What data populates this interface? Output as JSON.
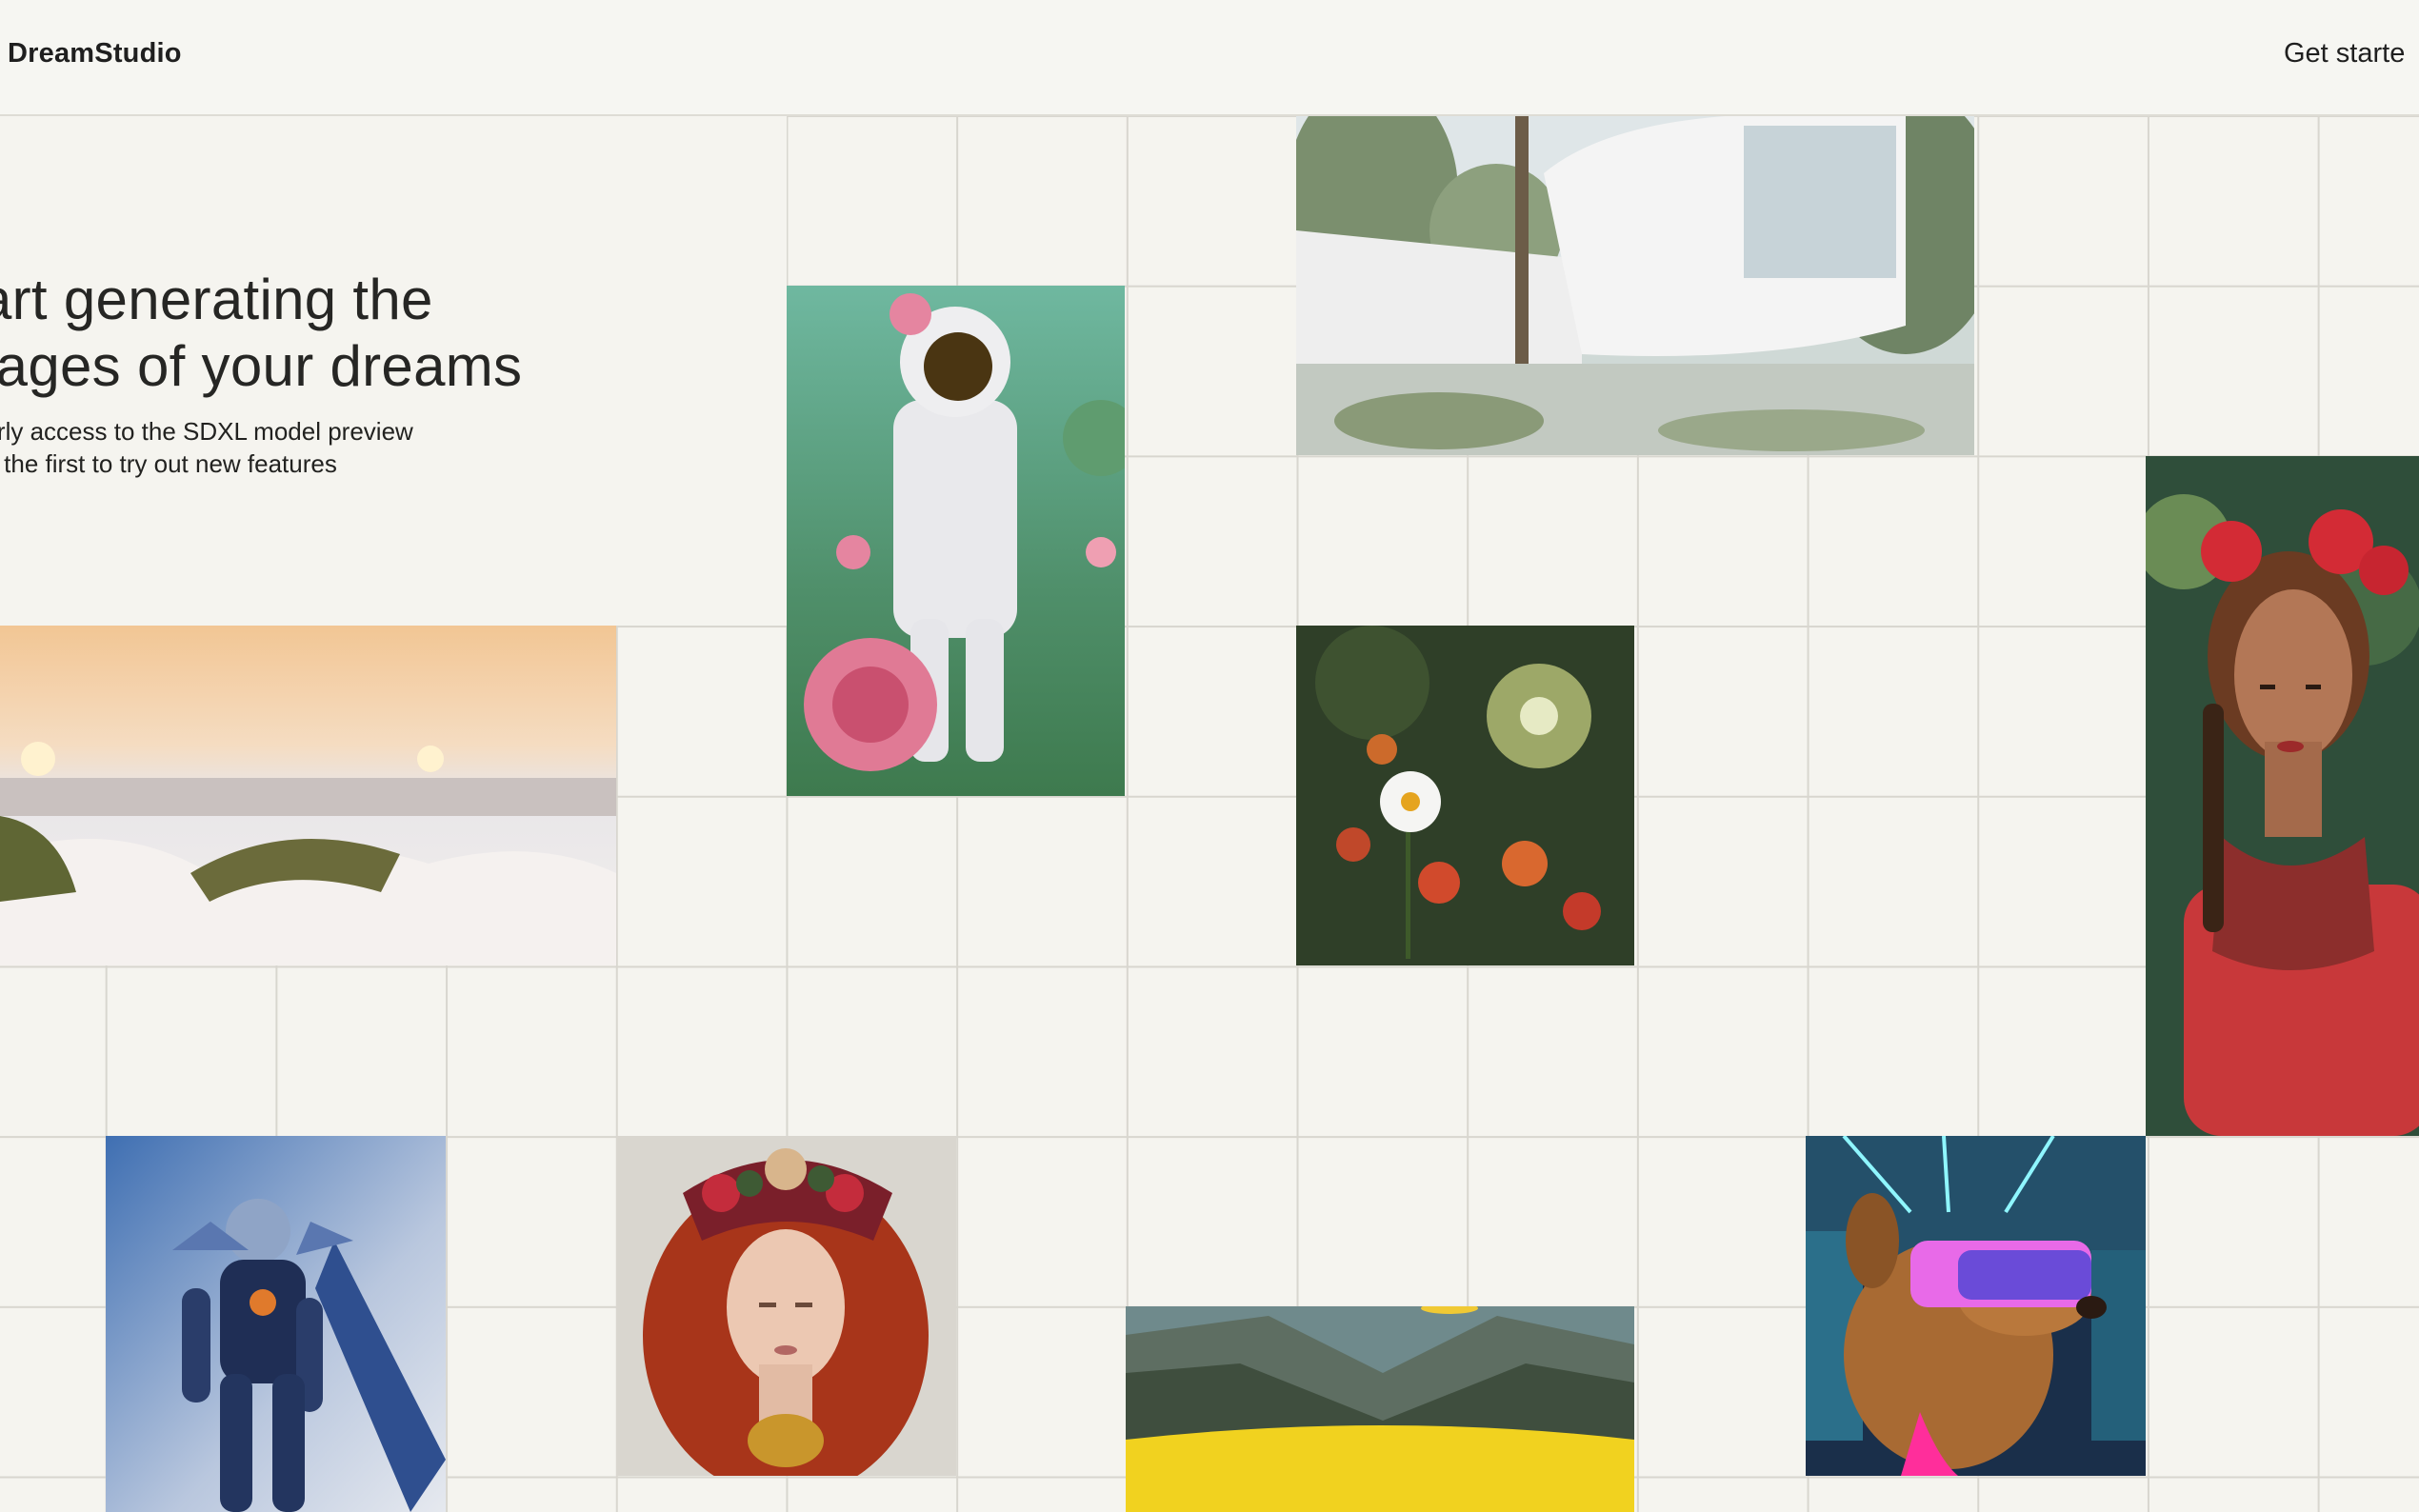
{
  "header": {
    "logo": "DreamStudio",
    "cta": "Get starte"
  },
  "hero": {
    "headline_line1": "tart generating the",
    "headline_line2": "nages of your dreams",
    "subtext_line1": "early access to the SDXL model preview",
    "subtext_line2": "be the first to try out new features"
  },
  "gallery": [
    {
      "name": "astronaut-roses-image"
    },
    {
      "name": "modern-house-image"
    },
    {
      "name": "frida-portrait-image"
    },
    {
      "name": "beach-dunes-image"
    },
    {
      "name": "daisy-flower-image"
    },
    {
      "name": "robot-figure-image"
    },
    {
      "name": "red-hair-crown-image"
    },
    {
      "name": "forest-valley-image"
    },
    {
      "name": "dog-vr-headset-image"
    }
  ]
}
